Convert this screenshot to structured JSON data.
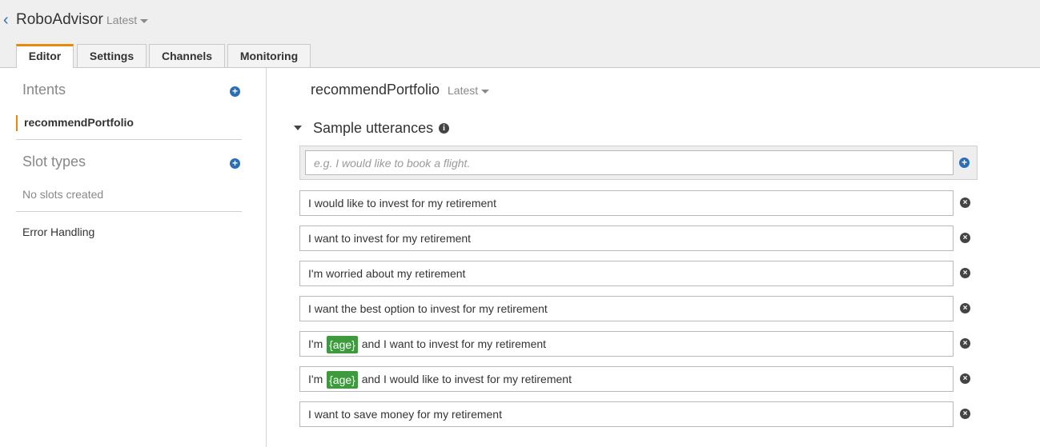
{
  "header": {
    "back_glyph": "‹",
    "app_title": "RoboAdvisor",
    "version": "Latest",
    "tabs": [
      {
        "label": "Editor",
        "active": true
      },
      {
        "label": "Settings",
        "active": false
      },
      {
        "label": "Channels",
        "active": false
      },
      {
        "label": "Monitoring",
        "active": false
      }
    ]
  },
  "sidebar": {
    "intents_title": "Intents",
    "intents": [
      {
        "label": "recommendPortfolio",
        "selected": true
      }
    ],
    "slot_types_title": "Slot types",
    "slot_types_empty": "No slots created",
    "error_handling": "Error Handling",
    "add_icon": "plus-circle-icon"
  },
  "main": {
    "intent_name": "recommendPortfolio",
    "intent_version": "Latest",
    "sample_utterances_title": "Sample utterances",
    "info_glyph": "i",
    "new_utterance_placeholder": "e.g. I would like to book a flight.",
    "add_glyph": "+",
    "remove_glyph": "×",
    "utterances": [
      {
        "before": "I would like to invest for my retirement",
        "slot": "",
        "after": ""
      },
      {
        "before": "I want to invest for my retirement",
        "slot": "",
        "after": ""
      },
      {
        "before": "I'm worried about my retirement",
        "slot": "",
        "after": ""
      },
      {
        "before": "I want the best option to invest for my retirement",
        "slot": "",
        "after": ""
      },
      {
        "before": "I'm ",
        "slot": "{age}",
        "after": " and I want to invest for my retirement"
      },
      {
        "before": "I'm ",
        "slot": "{age}",
        "after": " and I would like to invest for my retirement"
      },
      {
        "before": "I want to save money for my retirement",
        "slot": "",
        "after": ""
      }
    ]
  },
  "colors": {
    "accent_orange": "#e8890c",
    "link_blue": "#2a6eb8",
    "slot_green": "#3d9a3d"
  }
}
